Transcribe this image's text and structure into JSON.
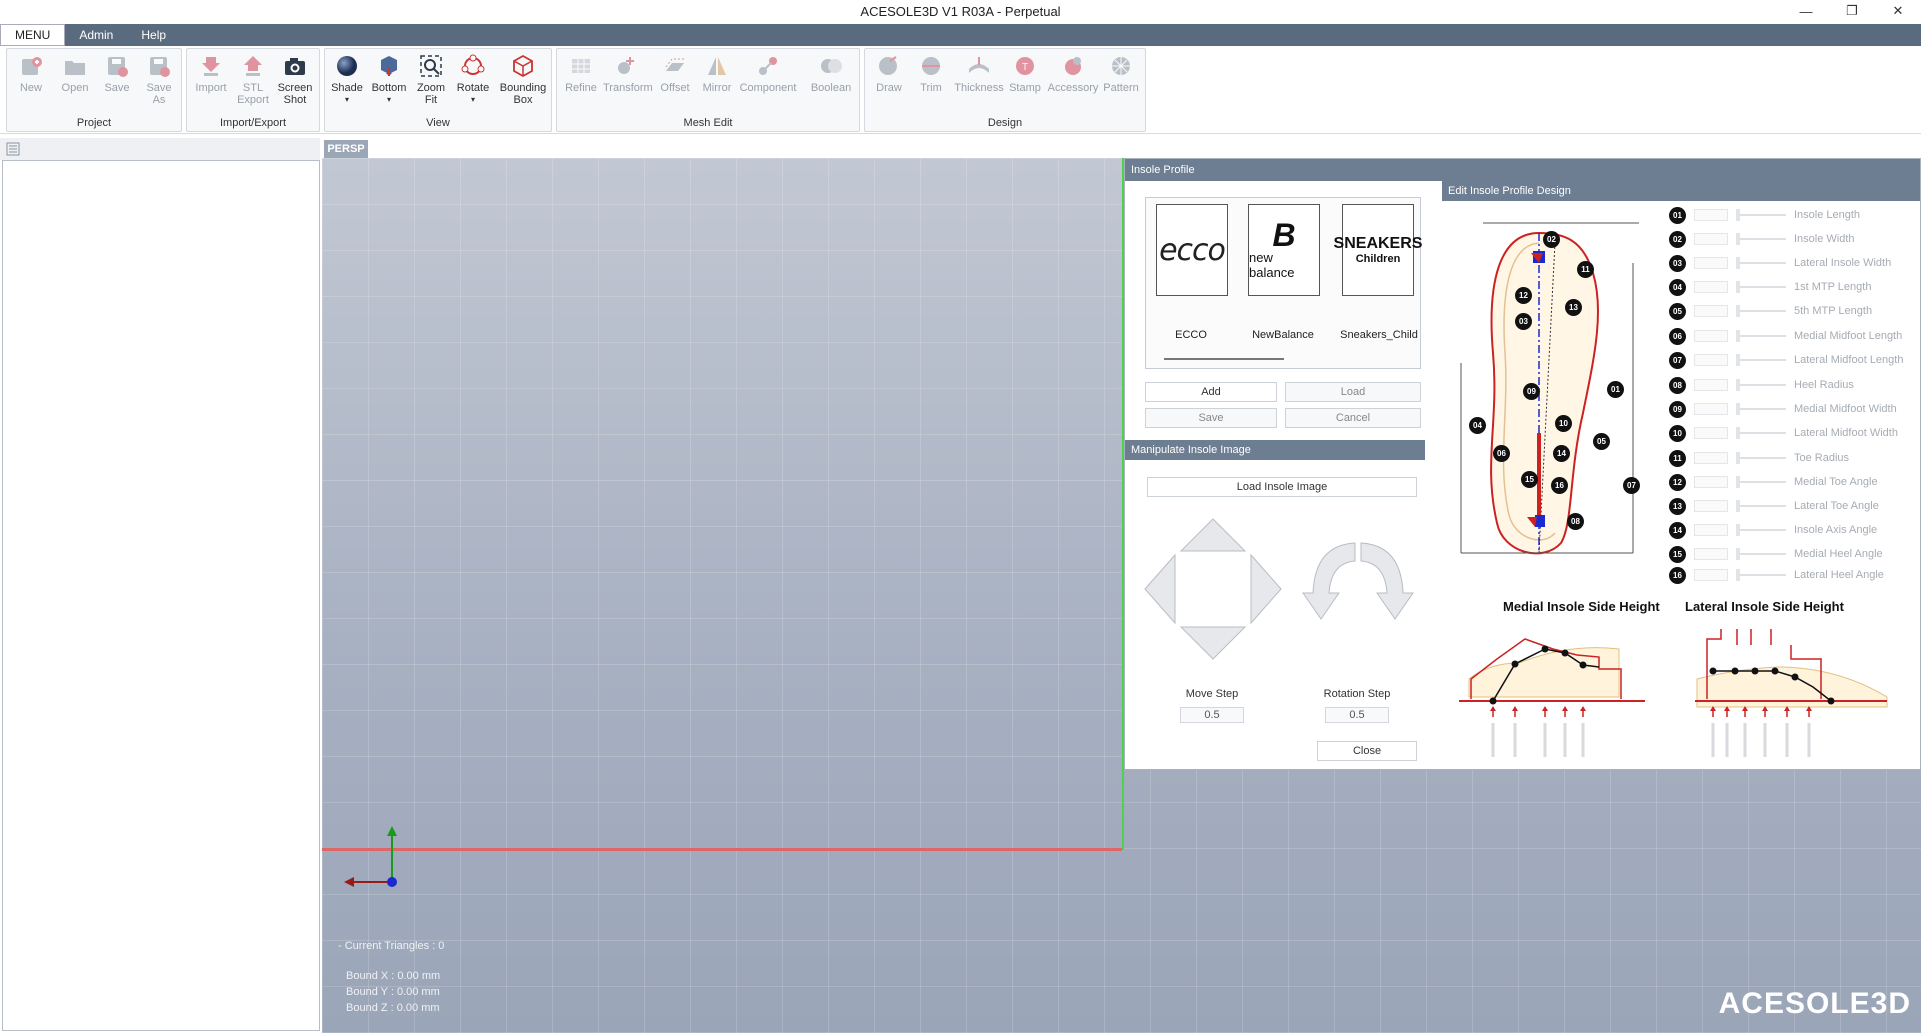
{
  "window": {
    "title": "ACESOLE3D V1 R03A - Perpetual",
    "minimize": "—",
    "maximize": "❐",
    "close": "✕"
  },
  "menu": [
    "MENU",
    "Admin",
    "Help"
  ],
  "ribbon": {
    "project": {
      "label": "Project",
      "tools": [
        "New",
        "Open",
        "Save",
        "Save\nAs"
      ]
    },
    "import_export": {
      "label": "Import/Export",
      "tools": [
        "Import",
        "STL\nExport",
        "Screen\nShot"
      ]
    },
    "view": {
      "label": "View",
      "tools": [
        "Shade",
        "Bottom",
        "Zoom\nFit",
        "Rotate",
        "Bounding\nBox"
      ]
    },
    "mesh_edit": {
      "label": "Mesh Edit",
      "tools": [
        "Refine",
        "Transform",
        "Offset",
        "Mirror",
        "Component",
        "Boolean"
      ]
    },
    "design": {
      "label": "Design",
      "tools": [
        "Draw",
        "Trim",
        "Thickness",
        "Stamp",
        "Accessory",
        "Pattern"
      ]
    }
  },
  "viewport": {
    "tab": "PERSP",
    "current_triangles": "- Current Triangles : 0",
    "bound_x": "Bound X : 0.00 mm",
    "bound_y": "Bound Y : 0.00 mm",
    "bound_z": "Bound Z : 0.00 mm",
    "logo": "ACESOLE3D"
  },
  "dialog": {
    "title": "Insole Profile",
    "edit_title": "Edit Insole Profile Design",
    "brands": [
      {
        "name": "ECCO",
        "logo": "ecco"
      },
      {
        "name": "NewBalance",
        "logo": "new balance"
      },
      {
        "name": "Sneakers_Child",
        "logo": "SNEAKERS",
        "logo_sub": "Children"
      }
    ],
    "add_label": "Add",
    "load_label": "Load",
    "save_label": "Save",
    "cancel_label": "Cancel",
    "manipulate_title": "Manipulate Insole Image",
    "load_image_label": "Load Insole Image",
    "move_step_label": "Move Step",
    "move_step_value": "0.5",
    "rotation_step_label": "Rotation Step",
    "rotation_step_value": "0.5",
    "close_label": "Close",
    "params": [
      {
        "num": "01",
        "label": "Insole Length"
      },
      {
        "num": "02",
        "label": "Insole Width"
      },
      {
        "num": "03",
        "label": "Lateral Insole Width"
      },
      {
        "num": "04",
        "label": "1st MTP Length"
      },
      {
        "num": "05",
        "label": "5th MTP Length"
      },
      {
        "num": "06",
        "label": "Medial Midfoot Length"
      },
      {
        "num": "07",
        "label": "Lateral Midfoot Length"
      },
      {
        "num": "08",
        "label": "Heel Radius"
      },
      {
        "num": "09",
        "label": "Medial Midfoot Width"
      },
      {
        "num": "10",
        "label": "Lateral Midfoot Width"
      },
      {
        "num": "11",
        "label": "Toe Radius"
      },
      {
        "num": "12",
        "label": "Medial Toe Angle"
      },
      {
        "num": "13",
        "label": "Lateral Toe Angle"
      },
      {
        "num": "14",
        "label": "Insole Axis Angle"
      },
      {
        "num": "15",
        "label": "Medial Heel Angle"
      },
      {
        "num": "16",
        "label": "Lateral Heel Angle"
      }
    ],
    "medial_height_title": "Medial Insole Side Height",
    "lateral_height_title": "Lateral Insole Side Height",
    "diagram_markers": [
      "01",
      "02",
      "03",
      "04",
      "05",
      "06",
      "07",
      "08",
      "09",
      "10",
      "11",
      "12",
      "13",
      "14",
      "15",
      "16"
    ]
  }
}
